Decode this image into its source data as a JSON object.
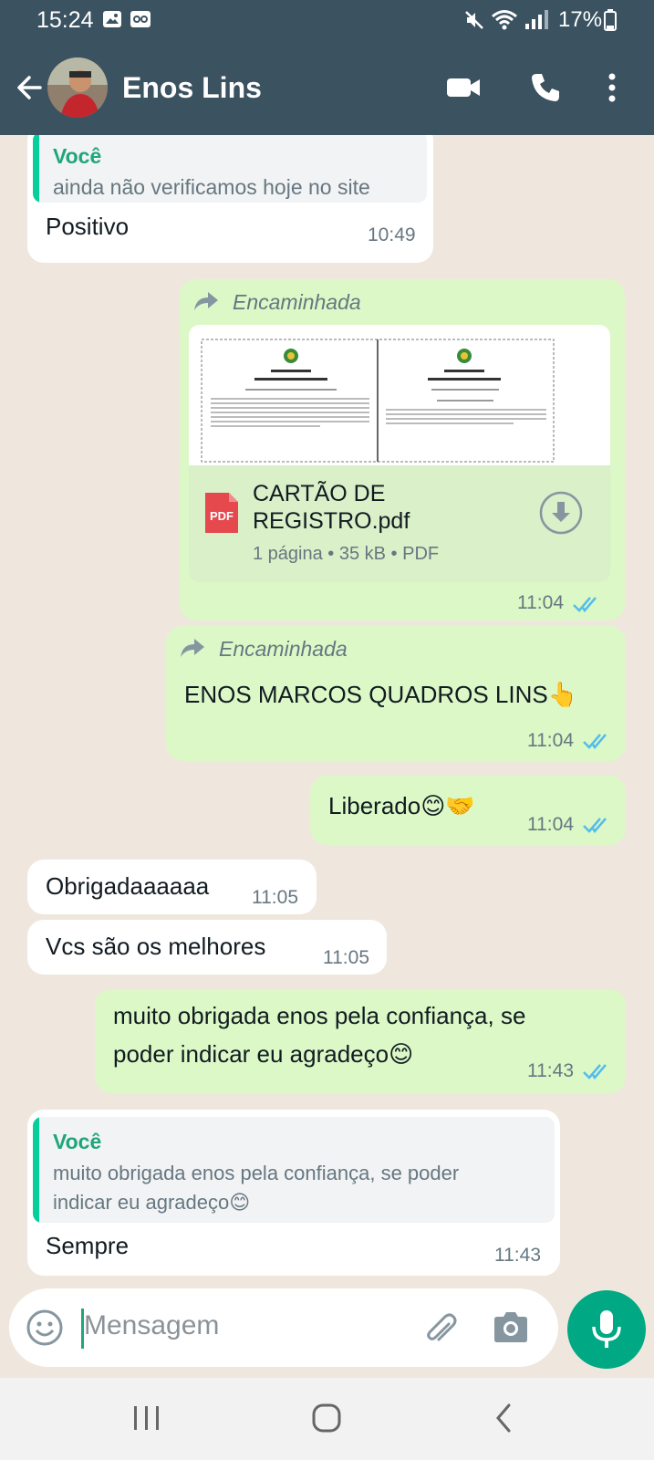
{
  "status_bar": {
    "time": "15:24",
    "battery": "17%"
  },
  "header": {
    "contact_name": "Enos Lins"
  },
  "messages": [
    {
      "type": "in",
      "quote_author": "Você",
      "quote_text": "ainda não verificamos hoje no site",
      "text": "Positivo",
      "time": "10:49"
    },
    {
      "type": "out",
      "forwarded_label": "Encaminhada",
      "document": {
        "name_line1": "CARTÃO DE",
        "name_line2": "REGISTRO.pdf",
        "info": "1 página • 35 kB • PDF",
        "badge": "PDF"
      },
      "time": "11:04",
      "status": "read"
    },
    {
      "type": "out",
      "forwarded_label": "Encaminhada",
      "text": "ENOS MARCOS QUADROS LINS👆",
      "time": "11:04",
      "status": "read"
    },
    {
      "type": "out",
      "text": "Liberado😊🤝",
      "time": "11:04",
      "status": "read"
    },
    {
      "type": "in",
      "text": "Obrigadaaaaaa",
      "time": "11:05"
    },
    {
      "type": "in",
      "text": "Vcs são os melhores",
      "time": "11:05"
    },
    {
      "type": "out",
      "text_line1": "muito obrigada enos pela confiança, se",
      "text_line2": "poder indicar eu agradeço😊",
      "time": "11:43",
      "status": "read"
    },
    {
      "type": "in",
      "quote_author": "Você",
      "quote_line1": "muito obrigada enos pela confiança, se poder",
      "quote_line2": "indicar eu agradeço😊",
      "text": "Sempre",
      "time": "11:43"
    }
  ],
  "composer": {
    "placeholder": "Mensagem"
  },
  "colors": {
    "header": "#3b5261",
    "incoming": "#ffffff",
    "outgoing": "#dcf8c6",
    "accent": "#00a884",
    "read_ticks": "#53bdeb"
  },
  "icons": [
    "back-arrow-icon",
    "video-call-icon",
    "voice-call-icon",
    "more-options-icon",
    "forward-icon",
    "pdf-file-icon",
    "download-icon",
    "double-check-icon",
    "emoji-icon",
    "attach-icon",
    "camera-icon",
    "mic-icon"
  ]
}
